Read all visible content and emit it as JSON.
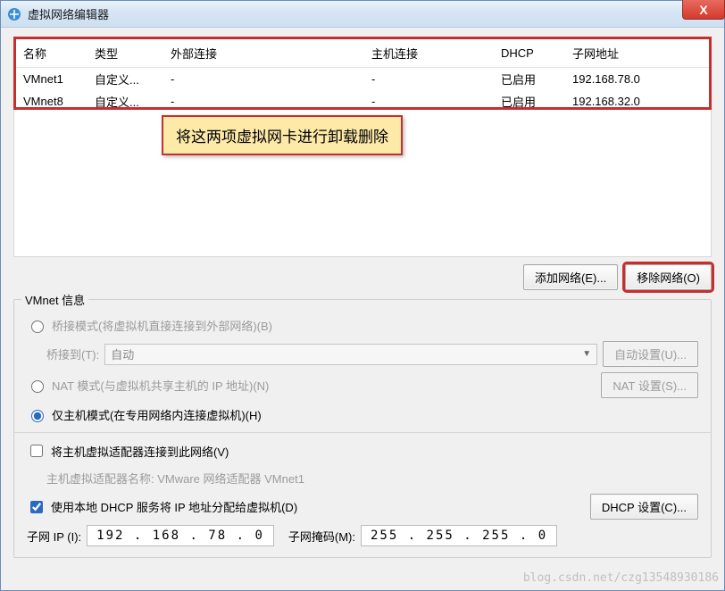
{
  "window": {
    "title": "虚拟网络编辑器",
    "close_x": "X"
  },
  "columns": {
    "name": "名称",
    "type": "类型",
    "ext": "外部连接",
    "host": "主机连接",
    "dhcp": "DHCP",
    "subnet": "子网地址"
  },
  "rows": [
    {
      "name": "VMnet1",
      "type": "自定义...",
      "ext": "-",
      "host": "-",
      "dhcp": "已启用",
      "subnet": "192.168.78.0"
    },
    {
      "name": "VMnet8",
      "type": "自定义...",
      "ext": "-",
      "host": "-",
      "dhcp": "已启用",
      "subnet": "192.168.32.0"
    }
  ],
  "callout": "将这两项虚拟网卡进行卸载删除",
  "buttons": {
    "add_net": "添加网络(E)...",
    "remove_net": "移除网络(O)",
    "auto_set": "自动设置(U)...",
    "nat_set": "NAT 设置(S)...",
    "dhcp_set": "DHCP 设置(C)..."
  },
  "info": {
    "legend": "VMnet 信息",
    "bridge_radio": "桥接模式(将虚拟机直接连接到外部网络)(B)",
    "bridge_to_label": "桥接到(T):",
    "bridge_to_value": "自动",
    "nat_radio": "NAT 模式(与虚拟机共享主机的 IP 地址)(N)",
    "hostonly_radio": "仅主机模式(在专用网络内连接虚拟机)(H)",
    "connect_adapter": "将主机虚拟适配器连接到此网络(V)",
    "adapter_name_label": "主机虚拟适配器名称: VMware 网络适配器 VMnet1",
    "use_dhcp": "使用本地 DHCP 服务将 IP 地址分配给虚拟机(D)",
    "subnet_ip_label": "子网 IP (I):",
    "subnet_ip_value": "192 . 168 . 78 .  0",
    "subnet_mask_label": "子网掩码(M):",
    "subnet_mask_value": "255 . 255 . 255 .  0"
  },
  "watermark": "blog.csdn.net/czg13548930186"
}
